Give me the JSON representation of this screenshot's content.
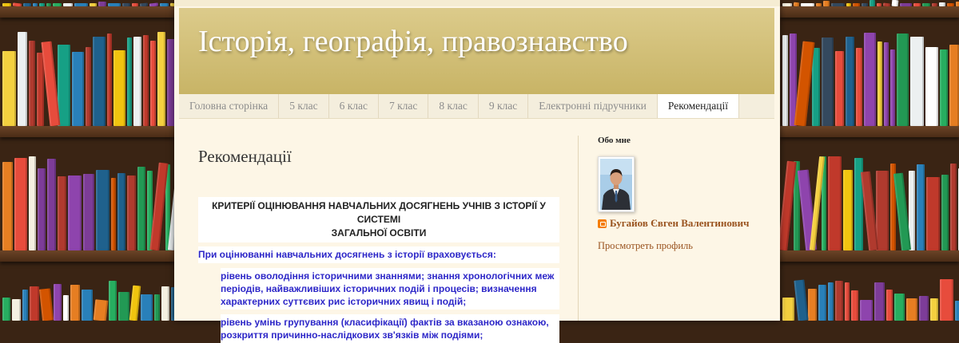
{
  "site": {
    "title": "Історія, географія, правознавство"
  },
  "nav": {
    "tabs": [
      {
        "label": "Головна сторінка",
        "active": false
      },
      {
        "label": "5 клас",
        "active": false
      },
      {
        "label": "6 клас",
        "active": false
      },
      {
        "label": "7 клас",
        "active": false
      },
      {
        "label": "8 клас",
        "active": false
      },
      {
        "label": "9 клас",
        "active": false
      },
      {
        "label": "Електронні підручники",
        "active": false
      },
      {
        "label": "Рекомендації",
        "active": true
      }
    ]
  },
  "post": {
    "title": "Рекомендації",
    "heading_line1": "КРИТЕРІЇ ОЦІНЮВАННЯ НАВЧАЛЬНИХ ДОСЯГНЕНЬ УЧНІВ З ІСТОРІЇ У СИСТЕМІ",
    "heading_line2": "ЗАГАЛЬНОЇ ОСВІТИ",
    "intro": "При оцінюванні навчальних досягнень з історії враховується:",
    "bullet1": "рівень оволодіння історичними знаннями; знання хронологічних меж періодів, найважливіших історичних подій і процесів; визначення характерних суттєвих рис історичних явищ і подій;",
    "bullet2": "рівень умінь групування (класифікації) фактів за вказаною ознакою, розкриття причинно-наслідкових зв'язків між подіями;"
  },
  "sidebar": {
    "widget_title": "Обо мне",
    "profile_name": "Бугайов Євген Валентинович",
    "profile_link": "Просмотреть профиль"
  },
  "colors": {
    "header_gold": "#c8b466",
    "body_text_blue": "#2d27c8",
    "link_brown": "#9a5420"
  }
}
